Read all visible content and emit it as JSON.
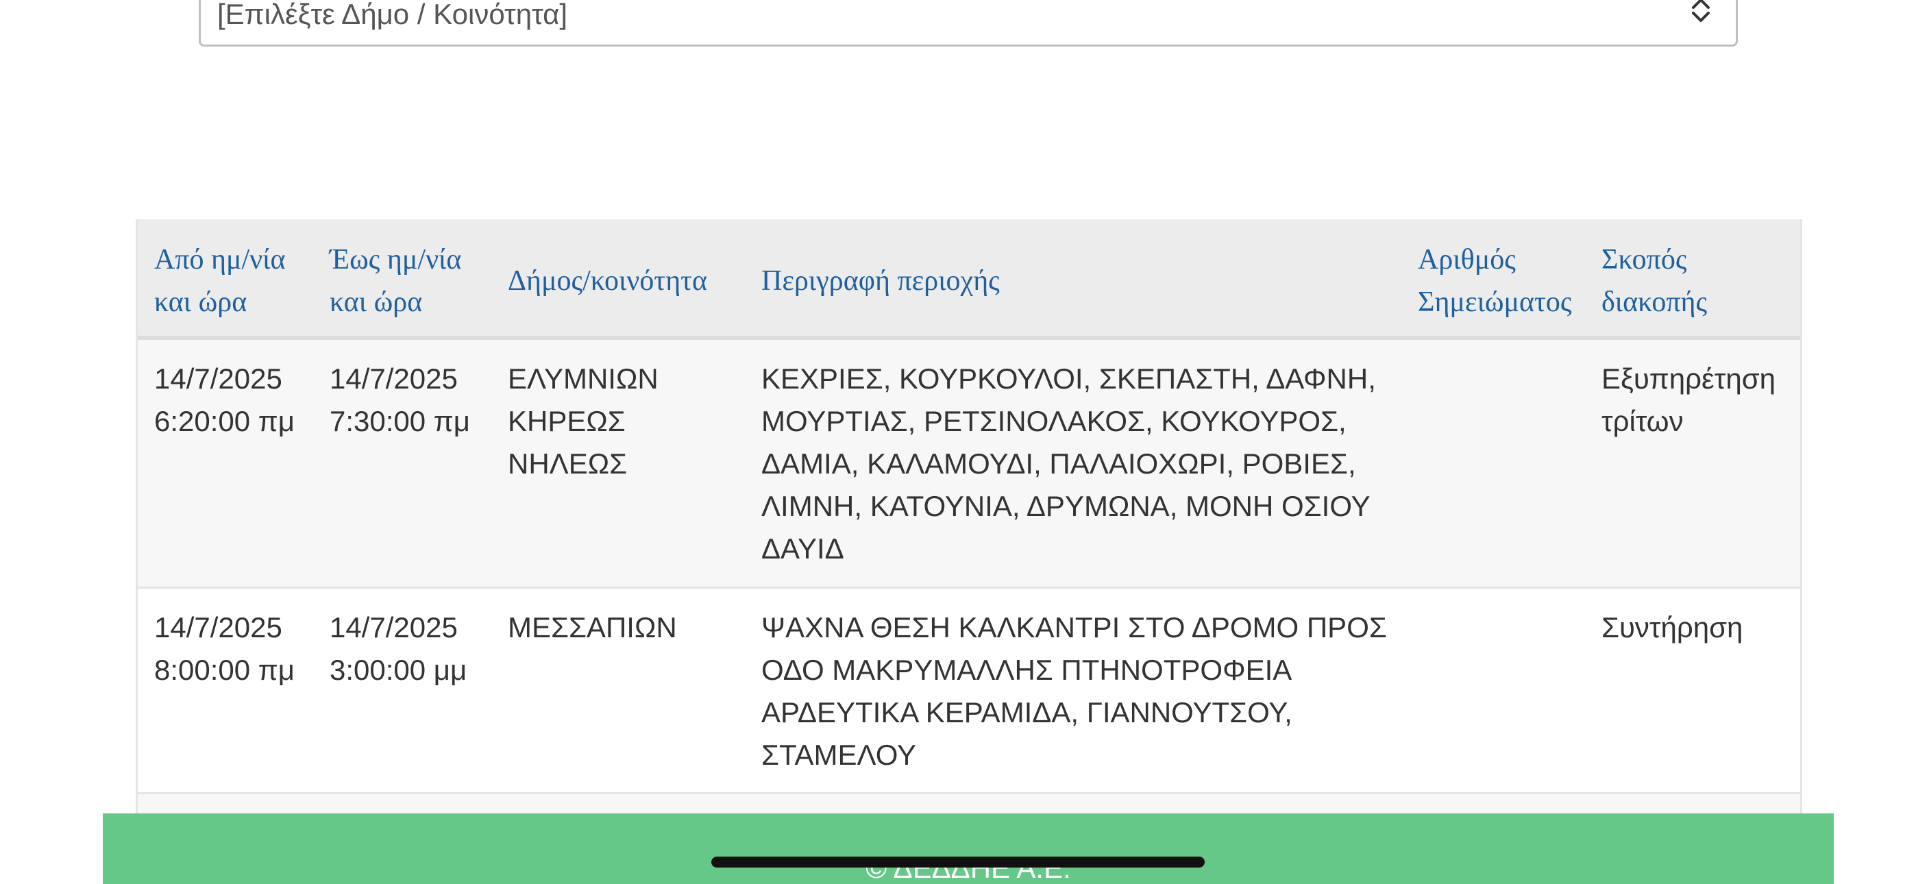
{
  "filter": {
    "select_value": "[Επιλέξτε Δήμο / Κοινότητα]"
  },
  "table": {
    "headers": [
      [
        "Από ημ/νία",
        "και ώρα"
      ],
      [
        "Έως ημ/νία",
        "και ώρα"
      ],
      [
        "Δήμος/κοινότητα"
      ],
      [
        "Περιγραφή περιοχής"
      ],
      [
        "Αριθμός",
        "Σημειώματος"
      ],
      [
        "Σκοπός",
        "διακοπής"
      ]
    ],
    "rows": [
      {
        "from": [
          "14/7/2025",
          "6:20:00 πμ"
        ],
        "to": [
          "14/7/2025",
          "7:30:00 πμ"
        ],
        "municipality": [
          "ΕΛΥΜΝΙΩΝ",
          "ΚΗΡΕΩΣ",
          "ΝΗΛΕΩΣ"
        ],
        "description": [
          "ΚΕΧΡΙΕΣ, ΚΟΥΡΚΟΥΛΟΙ, ΣΚΕΠΑΣΤΗ, ΔΑΦΝΗ,",
          "ΜΟΥΡΤΙΑΣ, ΡΕΤΣΙΝΟΛΑΚΟΣ, ΚΟΥΚΟΥΡΟΣ,",
          "ΔΑΜΙΑ, ΚΑΛΑΜΟΥΔΙ, ΠΑΛΑΙΟΧΩΡΙ, ΡΟΒΙΕΣ,",
          "ΛΙΜΝΗ, ΚΑΤΟΥΝΙΑ, ΔΡΥΜΩΝΑ, ΜΟΝΗ ΟΣΙΟΥ",
          "ΔΑΥΙΔ"
        ],
        "note_number": [],
        "purpose": [
          "Εξυπηρέτηση",
          "τρίτων"
        ]
      },
      {
        "from": [
          "14/7/2025",
          "8:00:00 πμ"
        ],
        "to": [
          "14/7/2025",
          "3:00:00 μμ"
        ],
        "municipality": [
          "ΜΕΣΣΑΠΙΩΝ"
        ],
        "description": [
          "ΨΑΧΝΑ ΘΕΣΗ ΚΑΛΚΑΝΤΡΙ ΣΤΟ ΔΡΟΜΟ ΠΡΟΣ",
          "ΟΔΟ ΜΑΚΡΥΜΑΛΛΗΣ ΠΤΗΝΟΤΡΟΦΕΙΑ",
          "ΑΡΔΕΥΤΙΚΑ ΚΕΡΑΜΙΔΑ, ΓΙΑΝΝΟΥΤΣΟΥ,",
          "ΣΤΑΜΕΛΟΥ"
        ],
        "note_number": [],
        "purpose": [
          "Συντήρηση"
        ]
      }
    ]
  },
  "footer": {
    "text": "© ΔΕΔΔΗΕ Α.Ε."
  },
  "colors": {
    "header_link": "#1f5f9e",
    "footer_bg": "#66c888"
  }
}
